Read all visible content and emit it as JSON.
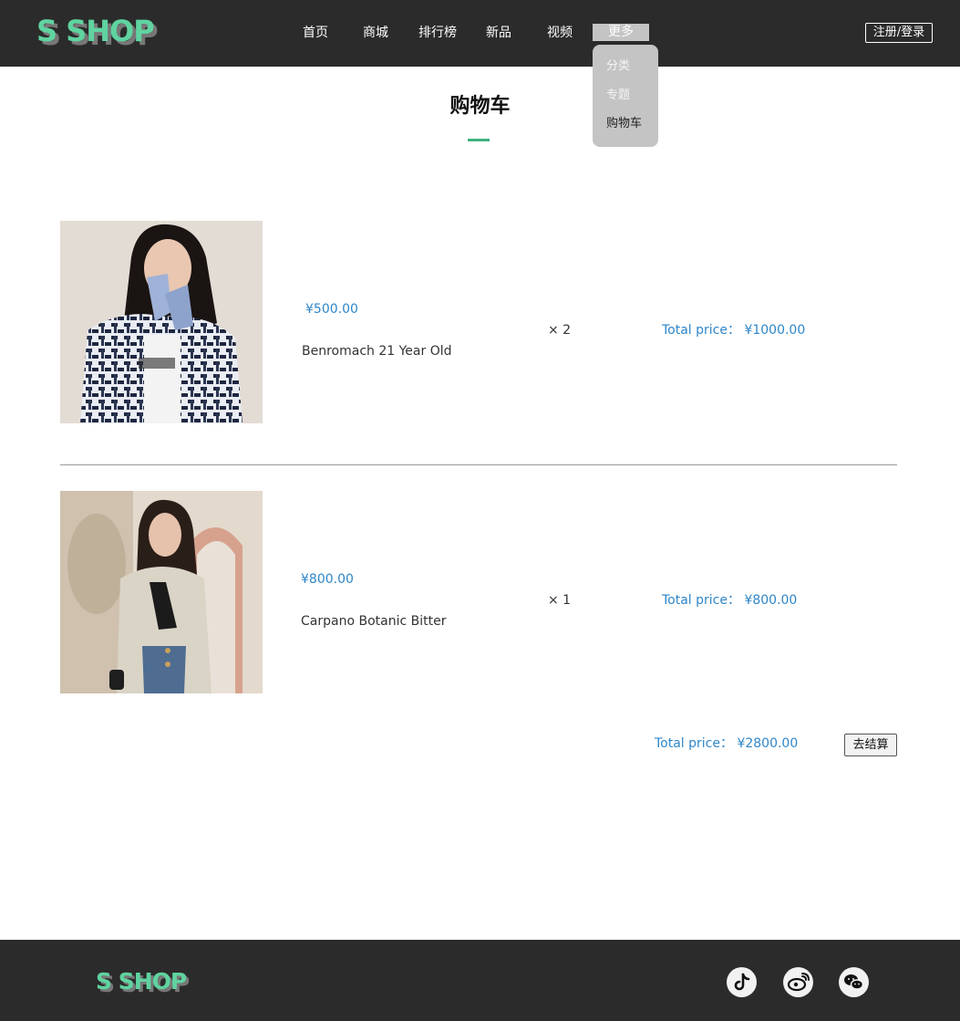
{
  "header": {
    "logo": "S SHOP",
    "nav": [
      "首页",
      "商城",
      "排行榜",
      "新品",
      "视频"
    ],
    "more_label": "更多",
    "login_label": "注册/登录",
    "dropdown": [
      "分类",
      "专题",
      "购物车"
    ]
  },
  "page": {
    "title": "购物车"
  },
  "cart": {
    "items": [
      {
        "price": "¥500.00",
        "name": "Benromach 21 Year Old",
        "qty": "× 2",
        "total": "Total price：  ¥1000.00"
      },
      {
        "price": "¥800.00",
        "name": "Carpano Botanic Bitter",
        "qty": "× 1",
        "total": "Total price：  ¥800.00"
      }
    ],
    "grand_total": "Total price：  ¥2800.00",
    "checkout_label": "去结算"
  },
  "footer": {
    "logo": "S SHOP",
    "social_icons": [
      "tiktok-icon",
      "weibo-icon",
      "wechat-icon"
    ]
  },
  "colors": {
    "header_bg": "#2b2b2b",
    "logo": "#5fd3a0",
    "accent_underline": "#3fb27f",
    "price": "#2f86c8"
  }
}
